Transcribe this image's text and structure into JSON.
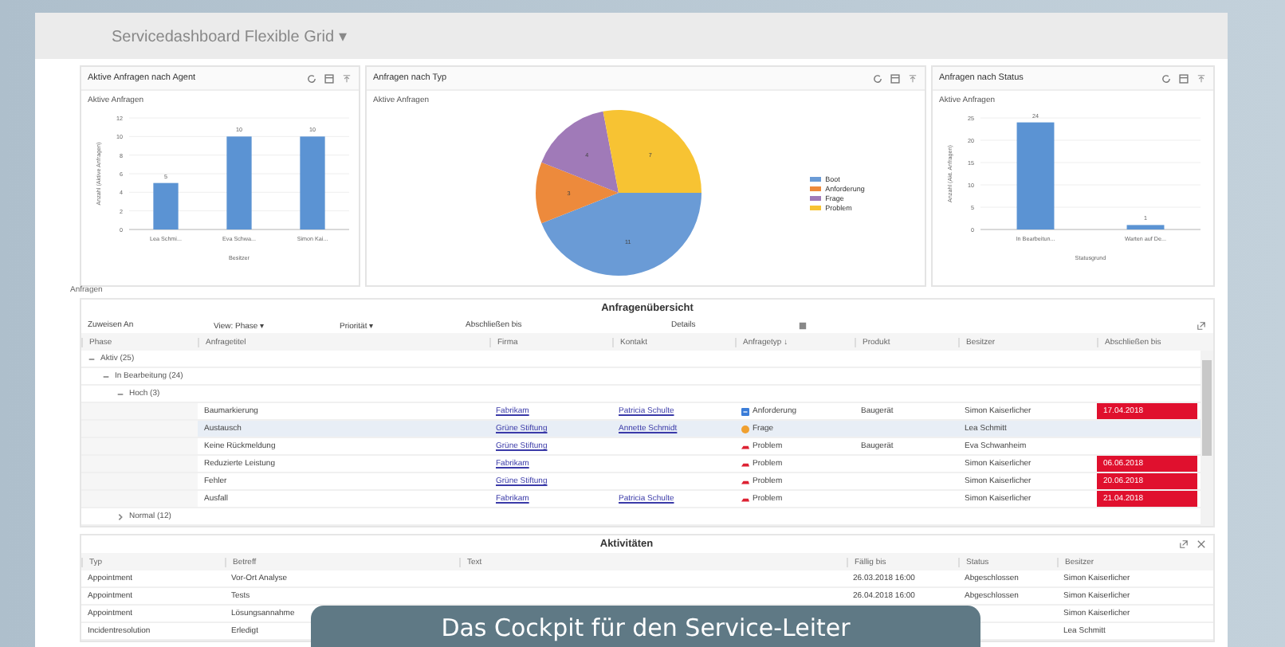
{
  "header": {
    "title": "Servicedashboard Flexible Grid ▾"
  },
  "panels": [
    {
      "title": "Aktive Anfragen nach Agent",
      "chart_data": {
        "type": "bar",
        "title": "Aktive Anfragen",
        "xlabel": "Besitzer",
        "ylabel": "Anzahl (Aktive Anfragen)",
        "categories": [
          "Lea Schmi...",
          "Eva Schwa...",
          "Simon Kai..."
        ],
        "values": [
          5,
          10,
          10
        ],
        "grid": true,
        "ylim": [
          0,
          12
        ],
        "yticks": [
          0,
          2,
          4,
          6,
          8,
          10,
          12
        ],
        "data_labels": true
      }
    },
    {
      "title": "Anfragen nach Typ",
      "chart_data": {
        "type": "pie",
        "title": "Aktive Anfragen",
        "categories": [
          "Boot",
          "Anforderung",
          "Frage",
          "Problem"
        ],
        "colors": [
          "#6a9bd6",
          "#ed8a3c",
          "#a07ab8",
          "#f7c333"
        ],
        "values": [
          11,
          3,
          4,
          7
        ],
        "data_labels": true
      }
    },
    {
      "title": "Anfragen nach Status",
      "chart_data": {
        "type": "bar",
        "title": "Aktive Anfragen",
        "xlabel": "Statusgrund",
        "ylabel": "Anzahl (Akt. Anfragen)",
        "categories": [
          "In Bearbeitun...",
          "Warten auf De..."
        ],
        "values": [
          24,
          1
        ],
        "grid": true,
        "ylim": [
          0,
          25
        ],
        "yticks": [
          0,
          5,
          10,
          15,
          20,
          25
        ],
        "data_labels": true
      }
    }
  ],
  "section_label": "Anfragen",
  "table": {
    "title": "Anfragenübersicht",
    "toolbar": [
      "Zuweisen An",
      "View: Phase ▾",
      "Priorität ▾",
      "Abschließen bis"
    ],
    "details": "Details",
    "columns": [
      "Phase",
      "Anfragetitel",
      "Firma",
      "Kontakt",
      "Anfragetyp ↓",
      "Produkt",
      "Besitzer",
      "Abschließen bis"
    ],
    "groups": [
      {
        "label": "Aktiv (25)",
        "expanded": true,
        "children": [
          {
            "label": "In Bearbeitung (24)",
            "expanded": true,
            "children": [
              {
                "label": "Hoch (3)",
                "expanded": true,
                "rows": [
                  {
                    "title": "Baumarkierung",
                    "company": "Fabrikam",
                    "contact": "Patricia Schulte",
                    "type": {
                      "kind": "request",
                      "label": "Anforderung"
                    },
                    "product": "Baugerät",
                    "owner": "Simon Kaiserlicher",
                    "due": "17.04.2018",
                    "overdue": true,
                    "selected": false
                  },
                  {
                    "title": "Austausch",
                    "company": "Grüne Stiftung",
                    "contact": "Annette Schmidt",
                    "type": {
                      "kind": "question",
                      "label": "Frage"
                    },
                    "owner": "Lea Schmitt",
                    "overdue": false,
                    "selected": true
                  },
                  {
                    "title": "Keine Rückmeldung",
                    "company": "Grüne Stiftung",
                    "type": {
                      "kind": "problem",
                      "label": "Problem"
                    },
                    "product": "Baugerät",
                    "owner": "Eva Schwanheim",
                    "overdue": false,
                    "selected": false
                  },
                  {
                    "title": "Reduzierte Leistung",
                    "company": "Fabrikam",
                    "type": {
                      "kind": "problem",
                      "label": "Problem"
                    },
                    "owner": "Simon Kaiserlicher",
                    "due": "06.06.2018",
                    "overdue": true,
                    "selected": false
                  },
                  {
                    "title": "Fehler",
                    "company": "Grüne Stiftung",
                    "type": {
                      "kind": "problem",
                      "label": "Problem"
                    },
                    "owner": "Simon Kaiserlicher",
                    "due": "20.06.2018",
                    "overdue": true,
                    "selected": false
                  },
                  {
                    "title": "Ausfall",
                    "company": "Fabrikam",
                    "contact": "Patricia Schulte",
                    "type": {
                      "kind": "problem",
                      "label": "Problem"
                    },
                    "owner": "Simon Kaiserlicher",
                    "due": "21.04.2018",
                    "overdue": true,
                    "selected": false
                  }
                ]
              },
              {
                "label": "Normal (12)",
                "expanded": false
              }
            ]
          }
        ]
      }
    ]
  },
  "activities": {
    "title": "Aktivitäten",
    "columns": [
      "Typ",
      "Betreff",
      "Text",
      "Fällig bis",
      "Status",
      "Besitzer"
    ],
    "rows": [
      {
        "type": "Appointment",
        "subject": "Vor-Ort Analyse",
        "due": "26.03.2018 16:00",
        "status": "Abgeschlossen",
        "owner": "Simon Kaiserlicher"
      },
      {
        "type": "Appointment",
        "subject": "Tests",
        "due": "26.04.2018 16:00",
        "status": "Abgeschlossen",
        "owner": "Simon Kaiserlicher"
      },
      {
        "type": "Appointment",
        "subject": "Lösungsannahme",
        "owner": "Simon Kaiserlicher"
      },
      {
        "type": "Incidentresolution",
        "subject": "Erledigt",
        "owner": "Lea Schmitt"
      }
    ]
  },
  "caption": "Das Cockpit für den Service-Leiter"
}
